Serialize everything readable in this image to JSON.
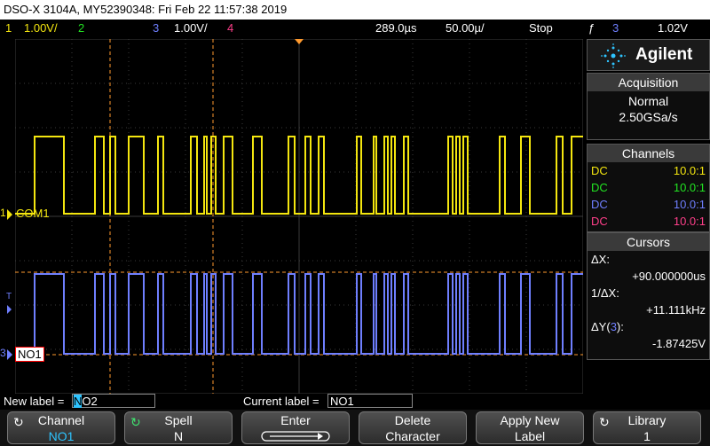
{
  "title": "DSO-X 3104A, MY52390348: Fri Feb 22 11:57:38 2019",
  "topbar": {
    "ch1_num": "1",
    "ch1_scale": "1.00V/",
    "ch2_num": "2",
    "ch3_num": "3",
    "ch3_scale": "1.00V/",
    "ch4_num": "4",
    "delay": "289.0µs",
    "timebase": "50.00µ/",
    "run_state": "Stop",
    "trigger_symbol": "ƒ",
    "trigger_channel": "3",
    "trigger_level": "1.02V"
  },
  "waveforms": {
    "com1_label": "COM1",
    "no1_label": "NO1",
    "ch1_marker": "1",
    "ch3_marker": "3",
    "trigger_marker": "T"
  },
  "panel": {
    "brand": "Agilent",
    "acquisition": {
      "header": "Acquisition",
      "mode": "Normal",
      "rate": "2.50GSa/s"
    },
    "channels": {
      "header": "Channels",
      "rows": [
        {
          "coupling": "DC",
          "probe": "10.0:1",
          "color": "#f4e60f"
        },
        {
          "coupling": "DC",
          "probe": "10.0:1",
          "color": "#22e322"
        },
        {
          "coupling": "DC",
          "probe": "10.0:1",
          "color": "#6f7fff"
        },
        {
          "coupling": "DC",
          "probe": "10.0:1",
          "color": "#ff3f8a"
        }
      ]
    },
    "cursors": {
      "header": "Cursors",
      "dx_label": "ΔX:",
      "dx_value": "+90.000000us",
      "inv_dx_label": "1/ΔX:",
      "inv_dx_value": "+11.111kHz",
      "dy_label_prefix": "ΔY(",
      "dy_channel": "3",
      "dy_label_suffix": "):",
      "dy_value": "-1.87425V"
    }
  },
  "labelbar": {
    "new_label_caption": "New label = ",
    "new_label_cursor_char": "N",
    "new_label_rest": "O2",
    "current_label_caption": "Current label = ",
    "current_label_value": "NO1"
  },
  "softkeys": [
    {
      "line1": "Channel",
      "line2": "NO1"
    },
    {
      "line1": "Spell",
      "line2": "N"
    },
    {
      "line1": "Enter",
      "line2": ""
    },
    {
      "line1": "Delete",
      "line2": "Character"
    },
    {
      "line1": "Apply New",
      "line2": "Label"
    },
    {
      "line1": "Library",
      "line2": "1"
    }
  ],
  "colors": {
    "ch1": "#f4e60f",
    "ch2": "#22e322",
    "ch3": "#6f7fff",
    "ch4": "#ff3f8a",
    "cursor": "#ff9a2e",
    "grid": "#3a3a3a"
  }
}
